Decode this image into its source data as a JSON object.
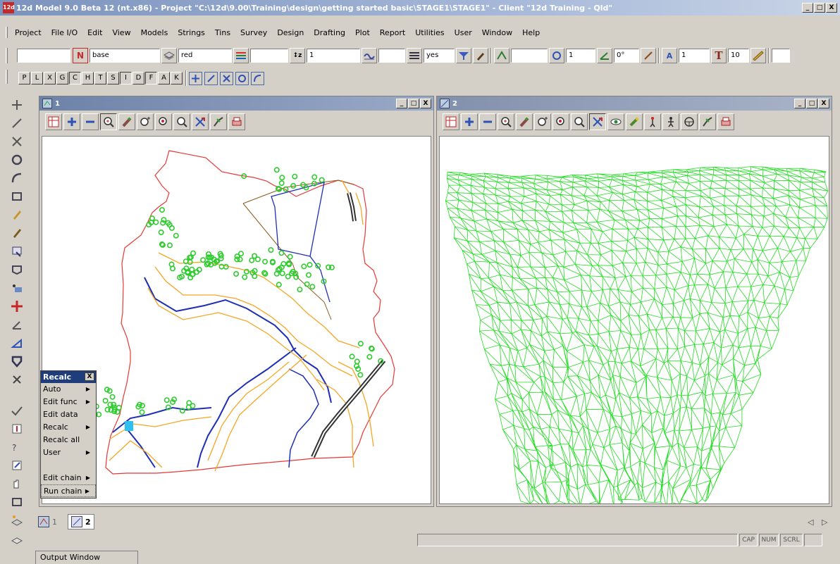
{
  "app": {
    "title": "12d Model 9.0 Beta 12 (nt.x86) - Project \"C:\\12d\\9.00\\Training\\design\\getting started basic\\STAGE1\\STAGE1\" - Client \"12d Training - Qld\"",
    "icon_text": "12d",
    "window_min": "_",
    "window_max": "□",
    "window_close": "X"
  },
  "menu": [
    "Project",
    "File I/O",
    "Edit",
    "View",
    "Models",
    "Strings",
    "Tins",
    "Survey",
    "Design",
    "Drafting",
    "Plot",
    "Report",
    "Utilities",
    "User",
    "Window",
    "Help"
  ],
  "toolbar1": {
    "model_field": "",
    "n_button": "N",
    "base_field": "base",
    "colour_field": "red",
    "linestyle_field": "",
    "weight_field": "1",
    "style_field": "",
    "yes_field": "yes",
    "text_field": "",
    "count_field": "1",
    "angle_field": "0°",
    "size_field": "1",
    "t_button": "T",
    "height_field": "10",
    "end_field": ""
  },
  "toolbar2": {
    "letters": [
      "P",
      "L",
      "X",
      "G",
      "C",
      "H",
      "T",
      "S",
      "I",
      "D",
      "F",
      "A",
      "K"
    ]
  },
  "views": [
    {
      "id": "1",
      "min": "_",
      "max": "□",
      "close": "X"
    },
    {
      "id": "2",
      "min": "_",
      "max": "□",
      "close": "X"
    }
  ],
  "recalc_menu": {
    "title": "Recalc",
    "close": "X",
    "items": [
      {
        "label": "Auto",
        "arrow": true
      },
      {
        "label": "Edit func",
        "arrow": true
      },
      {
        "label": "Edit data",
        "arrow": false
      },
      {
        "label": "Recalc",
        "arrow": true
      },
      {
        "label": "Recalc all",
        "arrow": false
      },
      {
        "label": "User",
        "arrow": true
      },
      {
        "label": "",
        "arrow": false
      },
      {
        "label": "Edit chain",
        "arrow": true
      },
      {
        "label": "Run chain",
        "arrow": true
      }
    ]
  },
  "tabs": [
    {
      "label": "1"
    },
    {
      "label": "2"
    }
  ],
  "nav": {
    "left": "◁",
    "right": "▷"
  },
  "status": {
    "cap": "CAP",
    "num": "NUM",
    "scrl": "SCRL"
  },
  "output_window": "Output Window",
  "colors": {
    "map_boundary": "#e53935",
    "contour": "#f5a623",
    "road": "#1e2fb5",
    "trees": "#2ecc2e",
    "tin": "#22dd22",
    "title_active": "#1f3d7a"
  }
}
